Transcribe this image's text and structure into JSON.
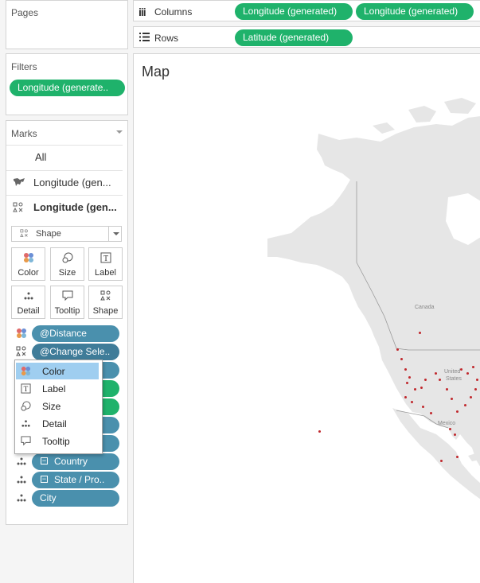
{
  "pages_title": "Pages",
  "filters_title": "Filters",
  "filters_pill": "Longitude (generate..",
  "marks": {
    "title": "Marks",
    "rows": [
      {
        "label": "All"
      },
      {
        "label": "Longitude (gen..."
      },
      {
        "label": "Longitude (gen..."
      }
    ],
    "shape_select": "Shape",
    "cards": [
      "Color",
      "Size",
      "Label",
      "Detail",
      "Tooltip",
      "Shape"
    ],
    "fields": [
      {
        "label": "@Distance"
      },
      {
        "label": "@Change Sele.."
      },
      {
        "label": "Country"
      },
      {
        "label": "State / Pro.."
      },
      {
        "label": "City"
      }
    ]
  },
  "context_menu": {
    "items": [
      {
        "label": "Color",
        "icon": "color-icon",
        "selected": true
      },
      {
        "label": "Label",
        "icon": "label-icon"
      },
      {
        "label": "Size",
        "icon": "size-icon"
      },
      {
        "label": "Detail",
        "icon": "detail-icon"
      },
      {
        "label": "Tooltip",
        "icon": "tooltip-icon"
      }
    ]
  },
  "columns": {
    "label": "Columns",
    "pills": [
      "Longitude (generated)",
      "Longitude (generated)"
    ]
  },
  "rows_shelf": {
    "label": "Rows",
    "pills": [
      "Latitude (generated)"
    ]
  },
  "map": {
    "title": "Map",
    "labels": {
      "canada": "Canada",
      "united": "United",
      "states": "States",
      "mexico": "Mexico"
    }
  },
  "colors": {
    "green_pill": "#1fb26b",
    "blue_pill": "#4a90ad",
    "menu_highlight": "#9fcef0",
    "map_land": "#e6e6e6",
    "city_dot": "#c0282d"
  }
}
